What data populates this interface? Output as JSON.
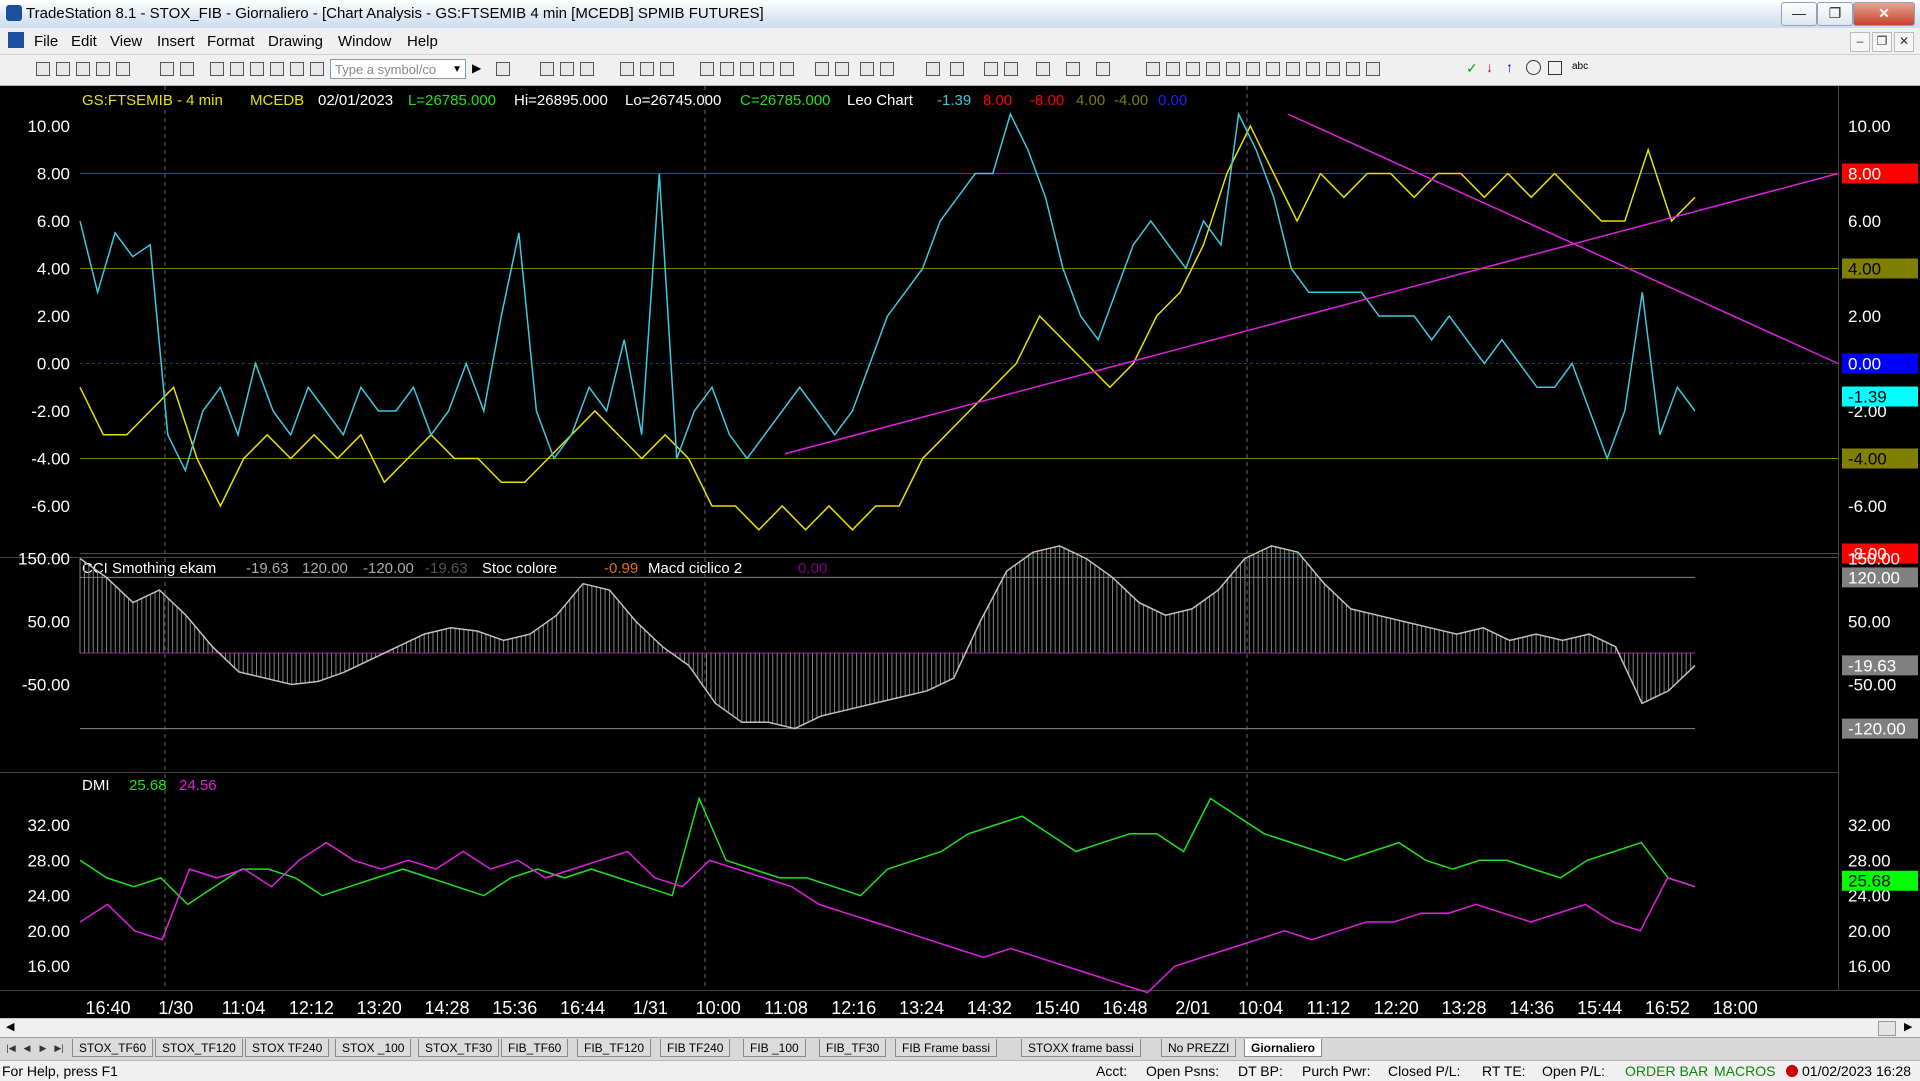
{
  "window": {
    "title": "TradeStation 8.1 - STOX_FIB - Giornaliero - [Chart Analysis - GS:FTSEMIB  4 min  [MCEDB] SPMIB FUTURES]"
  },
  "menu": [
    "File",
    "Edit",
    "View",
    "Insert",
    "Format",
    "Drawing",
    "Window",
    "Help"
  ],
  "toolbar": {
    "symbol_placeholder": "Type a symbol/co"
  },
  "price_header": {
    "symbol": "GS:FTSEMIB - 4 min",
    "feed": "MCEDB",
    "date": "02/01/2023",
    "last": "L=26785.000",
    "high": "Hi=26895.000",
    "low": "Lo=26745.000",
    "close": "C=26785.000",
    "indicator": "Leo Chart",
    "v1": "-1.39",
    "v2": "8.00",
    "v3": "-8.00",
    "v4": "4.00",
    "v5": "-4.00",
    "v6": "0.00"
  },
  "cci_header": {
    "name": "CCI Smothing ekam",
    "v1": "-19.63",
    "v2": "120.00",
    "v3": "-120.00",
    "v4": "-19.63",
    "stoc": "Stoc colore",
    "stoc_v": "-0.99",
    "macd": "Macd ciclico 2",
    "macd_v": "0.00"
  },
  "dmi_header": {
    "name": "DMI",
    "plus": "25.68",
    "minus": "24.56"
  },
  "price_axis": [
    "10.00",
    "8.00",
    "6.00",
    "4.00",
    "2.00",
    "0.00",
    "-2.00",
    "-4.00",
    "-6.00"
  ],
  "cci_axis": [
    "150.00",
    "50.00",
    "-50.00"
  ],
  "dmi_axis": [
    "32.00",
    "28.00",
    "24.00",
    "20.00",
    "16.00"
  ],
  "price_right_labels": [
    {
      "text": "10.00"
    },
    {
      "text": "8.00",
      "badge": "8.00",
      "color": "#ff0000"
    },
    {
      "text": "6.00"
    },
    {
      "text": "4.00",
      "badge": "4.00",
      "color": "#808000"
    },
    {
      "text": "2.00"
    },
    {
      "text": "0.00",
      "badge": "0.00",
      "color": "#0000ff"
    },
    {
      "text": "-2.00",
      "badge": "-1.39",
      "color": "#00ffff"
    },
    {
      "text": "-4.00",
      "badge": "-4.00",
      "color": "#808000"
    },
    {
      "text": "-6.00"
    },
    {
      "text": "-8.00",
      "badge": "-8.00",
      "color": "#ff0000"
    }
  ],
  "cci_right_labels": [
    {
      "text": "150.00"
    },
    {
      "text": "120.00",
      "badge": "120.00",
      "color": "#808080"
    },
    {
      "text": "50.00"
    },
    {
      "text": "-50.00",
      "badge": "-19.63",
      "color": "#808080"
    },
    {
      "text": "-120.00",
      "badge": "-120.00",
      "color": "#808080"
    }
  ],
  "dmi_right_labels": [
    {
      "text": "32.00"
    },
    {
      "text": "28.00"
    },
    {
      "text": "24.00",
      "badge": "25.68",
      "color": "#00ff00"
    },
    {
      "text": "20.00"
    },
    {
      "text": "16.00"
    }
  ],
  "time_labels": [
    "16:40",
    "1/30",
    "11:04",
    "12:12",
    "13:20",
    "14:28",
    "15:36",
    "16:44",
    "1/31",
    "10:00",
    "11:08",
    "12:16",
    "13:24",
    "14:32",
    "15:40",
    "16:48",
    "2/01",
    "10:04",
    "11:12",
    "12:20",
    "13:28",
    "14:36",
    "15:44",
    "16:52",
    "18:00"
  ],
  "tabs": [
    "STOX_TF60",
    "STOX_TF120",
    "STOX TF240",
    "STOX _100",
    "STOX_TF30",
    "FIB_TF60",
    "FIB_TF120",
    "FIB TF240",
    "FIB _100",
    "FIB_TF30",
    "FIB Frame bassi",
    "STOXX frame bassi",
    "No PREZZI",
    "Giornaliero"
  ],
  "active_tab": "Giornaliero",
  "status": {
    "help": "For Help, press F1",
    "acct": "Acct:",
    "open_psns": "Open Psns:",
    "dt_bp": "DT BP:",
    "purch_pwr": "Purch Pwr:",
    "closed_pl": "Closed P/L:",
    "rt_te": "RT TE:",
    "open_pl": "Open P/L:",
    "order_bar": "ORDER BAR",
    "macros": "MACROS",
    "datetime": "01/02/2023 16:28"
  },
  "colors": {
    "cyan": "#40c8e0",
    "yellow": "#e8e000",
    "magenta": "#e020e0",
    "green": "#20e020",
    "red": "#ff0000",
    "olive": "#808000",
    "blue": "#2020ff"
  },
  "chart_data": [
    {
      "type": "line",
      "title": "GS:FTSEMIB - 4 min",
      "ylim": [
        -7,
        11
      ],
      "series": [
        {
          "name": "cyan",
          "values": [
            6,
            3,
            5.5,
            4.5,
            5,
            -3,
            -4.5,
            -2,
            -1,
            -3,
            0,
            -2,
            -3,
            -1,
            -2,
            -3,
            -1,
            -2,
            -2,
            -1,
            -3,
            -2,
            0,
            -2,
            2,
            5.5,
            -2,
            -4,
            -3,
            -1,
            -2,
            1,
            -3,
            8,
            -4,
            -2,
            -1,
            -3,
            -4,
            -3,
            -2,
            -1,
            -2,
            -3,
            -2,
            0,
            2,
            3,
            4,
            6,
            7,
            8,
            8,
            10.5,
            9,
            7,
            4,
            2,
            1,
            3,
            5,
            6,
            5,
            4,
            6,
            5,
            10.5,
            9,
            7,
            4,
            3,
            3,
            3,
            3,
            2,
            2,
            2,
            1,
            2,
            1,
            0,
            1,
            0,
            -1,
            -1,
            0,
            -2,
            -4,
            -2,
            3,
            -3,
            -1,
            -2
          ]
        },
        {
          "name": "yellow",
          "values": [
            -1,
            -3,
            -3,
            -2,
            -1,
            -4,
            -6,
            -4,
            -3,
            -4,
            -3,
            -4,
            -3,
            -5,
            -4,
            -3,
            -4,
            -4,
            -5,
            -5,
            -4,
            -3,
            -2,
            -3,
            -4,
            -3,
            -4,
            -6,
            -6,
            -7,
            -6,
            -7,
            -6,
            -7,
            -6,
            -6,
            -4,
            -3,
            -2,
            -1,
            0,
            2,
            1,
            0,
            -1,
            0,
            2,
            3,
            5,
            8,
            10,
            8,
            6,
            8,
            7,
            8,
            8,
            7,
            8,
            8,
            7,
            8,
            7,
            8,
            7,
            6,
            6,
            9,
            6,
            7
          ]
        }
      ]
    },
    {
      "type": "line",
      "title": "CCI Smothing ekam",
      "ylim": [
        -130,
        190
      ],
      "series": [
        {
          "name": "CCI",
          "values": [
            150,
            120,
            80,
            100,
            60,
            10,
            -30,
            -40,
            -50,
            -45,
            -30,
            -10,
            10,
            30,
            40,
            35,
            20,
            30,
            60,
            110,
            100,
            50,
            10,
            -20,
            -80,
            -110,
            -110,
            -120,
            -100,
            -90,
            -80,
            -70,
            -60,
            -40,
            50,
            130,
            160,
            170,
            150,
            120,
            80,
            60,
            70,
            100,
            150,
            170,
            160,
            110,
            70,
            60,
            50,
            40,
            30,
            40,
            20,
            30,
            20,
            30,
            10,
            -80,
            -60,
            -20
          ]
        }
      ]
    },
    {
      "type": "line",
      "title": "DMI",
      "ylim": [
        13,
        36
      ],
      "series": [
        {
          "name": "25.68",
          "values": [
            28,
            26,
            25,
            26,
            23,
            25,
            27,
            27,
            26,
            24,
            25,
            26,
            27,
            26,
            25,
            24,
            26,
            27,
            26,
            27,
            26,
            25,
            24,
            35,
            28,
            27,
            26,
            26,
            25,
            24,
            27,
            28,
            29,
            31,
            32,
            33,
            31,
            29,
            30,
            31,
            31,
            29,
            35,
            33,
            31,
            30,
            29,
            28,
            29,
            30,
            28,
            27,
            28,
            28,
            27,
            26,
            28,
            29,
            30,
            26,
            25
          ]
        },
        {
          "name": "24.56",
          "values": [
            21,
            23,
            20,
            19,
            27,
            26,
            27,
            25,
            28,
            30,
            28,
            27,
            28,
            27,
            29,
            27,
            28,
            26,
            27,
            28,
            29,
            26,
            25,
            28,
            27,
            26,
            25,
            23,
            22,
            21,
            20,
            19,
            18,
            17,
            18,
            17,
            16,
            15,
            14,
            13,
            16,
            17,
            18,
            19,
            20,
            19,
            20,
            21,
            21,
            22,
            22,
            23,
            22,
            21,
            22,
            23,
            21,
            20,
            26,
            25
          ]
        }
      ]
    }
  ]
}
